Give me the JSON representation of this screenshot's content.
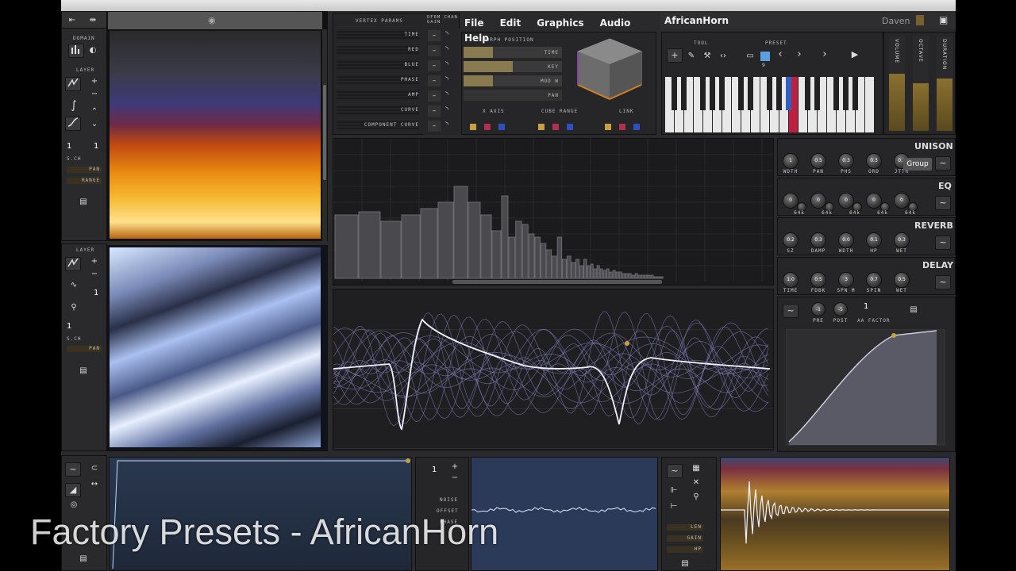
{
  "window": {
    "title_bar": "",
    "app_title": "AfricanHorn",
    "user": "Daven"
  },
  "menu": [
    "File",
    "Edit",
    "Graphics",
    "Audio",
    "Help"
  ],
  "left_top": {
    "domain_label": "DOMAIN",
    "layer_label": "LAYER",
    "layer_num": "1",
    "sub_num": "1",
    "sch_label": "S.CH",
    "pan_label": "PAN",
    "range_label": "RANGE"
  },
  "left_bottom": {
    "layer_label": "LAYER",
    "layer_num": "1",
    "sub_num": "1",
    "sch_label": "S.CH",
    "pan_label": "PAN"
  },
  "vertex": {
    "header": "VERTEX PARAMS",
    "dfrm": "DFRM CHAN GAIN",
    "rows": [
      "TIME",
      "RED",
      "BLUE",
      "PHASE",
      "AMP",
      "CURVE",
      "COMPONENT CURVE"
    ],
    "dash": "–"
  },
  "morph": {
    "title": "MORPH POSITION",
    "rows": [
      "TIME",
      "KEY",
      "MOD W",
      "PAN"
    ],
    "xaxis": "X AXIS",
    "cube": "CUBE RANGE",
    "link": "LINK"
  },
  "tool": {
    "tool_label": "TOOL",
    "preset_label": "PRESET",
    "preset_num": "9"
  },
  "vertical_labels": [
    "VOLUME",
    "OCTAVE",
    "DURATION"
  ],
  "unison": {
    "title": "UNISON",
    "group_btn": "Group",
    "knobs": [
      {
        "v": "1",
        "l": "WDTH"
      },
      {
        "v": "0.5",
        "l": "PAN"
      },
      {
        "v": "0.3",
        "l": "PHS"
      },
      {
        "v": "0.3",
        "l": "ORD"
      },
      {
        "v": "0.1",
        "l": "JTTR"
      }
    ]
  },
  "eq": {
    "title": "EQ",
    "knobs": [
      "0",
      "0",
      "0",
      "0",
      "0"
    ],
    "small": [
      "64",
      "64",
      "64",
      "64",
      "64"
    ],
    "small_suffix": "k"
  },
  "reverb": {
    "title": "REVERB",
    "knobs": [
      {
        "v": "0.2",
        "l": "SZ"
      },
      {
        "v": "0.3",
        "l": "DAMP"
      },
      {
        "v": "0.0",
        "l": "WDTH"
      },
      {
        "v": "0.1",
        "l": "HP"
      },
      {
        "v": "0.3",
        "l": "WET"
      }
    ]
  },
  "delay": {
    "title": "DELAY",
    "knobs": [
      {
        "v": "1.0",
        "l": "TIME"
      },
      {
        "v": "0.5",
        "l": "FDBK"
      },
      {
        "v": "3",
        "l": "SPN M"
      },
      {
        "v": "0.7",
        "l": "SPIN"
      },
      {
        "v": "0.5",
        "l": "WET"
      }
    ]
  },
  "env": {
    "pre_val": "-1",
    "post_val": "-5",
    "pre": "PRE",
    "post": "POST",
    "aa_val": "1",
    "aa": "AA FACTOR"
  },
  "bottom_mid": {
    "num": "1",
    "noise": "NOISE",
    "offset": "OFFSET",
    "phase": "PHASE"
  },
  "bottom_right": {
    "len": "LEN",
    "gain": "GAIN",
    "hp": "HP"
  },
  "overlay": "Factory Presets - AfricanHorn",
  "colors": {
    "accent_gold": "#c8a040",
    "panel_bg": "#1e1e20",
    "waveform": "#e8e8ff"
  }
}
